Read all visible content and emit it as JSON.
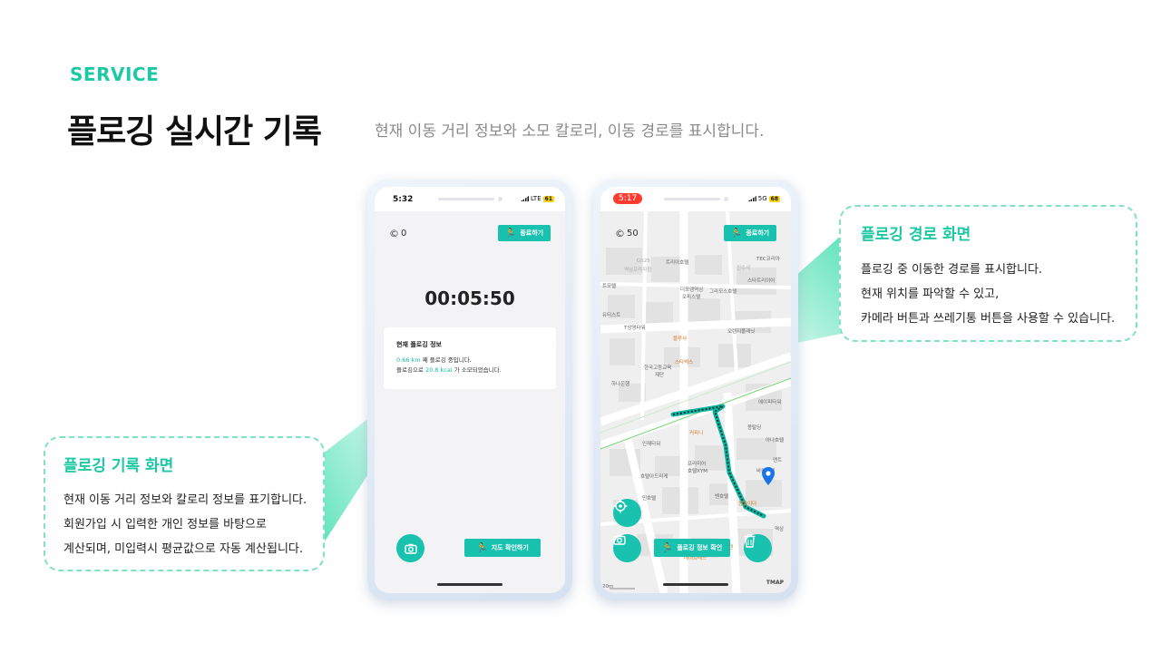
{
  "header": {
    "section_label": "SERVICE",
    "title": "플로깅 실시간 기록",
    "subtitle": "현재 이동 거리 정보와 소모 칼로리, 이동 경로를 표시합니다."
  },
  "phone_record": {
    "status_time": "5:32",
    "network": "LTE",
    "battery": "61",
    "coins": "0",
    "stop_button": "종료하기",
    "timer": "00:05:50",
    "info_title": "현재 플로깅 정보",
    "distance": "0.66 km",
    "distance_suffix": " 째 플로깅 중입니다.",
    "calorie_prefix": "플로깅으로 ",
    "calories": "20.8 kcal",
    "calorie_suffix": " 가 소모되었습니다.",
    "map_button": "지도 확인하기"
  },
  "phone_route": {
    "status_time": "5:17",
    "network": "5G",
    "battery": "68",
    "coins": "50",
    "stop_button": "종료하기",
    "info_button": "플로깅 정보 확인",
    "map_brand": "TMAP",
    "scale": "20m",
    "map_labels": [
      "GS25",
      "역삼프라자점",
      "트리아호텔",
      "진수사",
      "TEC코리아",
      "더포엠역삼",
      "오피스텔",
      "그라모스호텔",
      "스타트리이어",
      "트모텔",
      "유티스트",
      "T상영타워",
      "블루사",
      "오렌지플래닛",
      "스타벅스",
      "한국고등교육",
      "재단",
      "하나은행",
      "에이피타워",
      "몽탈딩",
      "커피니",
      "아나호텔",
      "인재타워",
      "프리미어",
      "호텔XYM",
      "호텔아드리게",
      "앤트",
      "바캉호텔",
      "민호텔",
      "벤호텔",
      "몽들이다",
      "마구로젠",
      "데이브레드",
      "역삼"
    ],
    "accent_route": "#0fb5a2"
  },
  "callout_record": {
    "title": "플로깅 기록 화면",
    "lines": [
      "현재 이동 거리 정보와 칼로리 정보를 표기합니다.",
      "회원가입 시 입력한 개인 정보를 바탕으로",
      "계산되며, 미입력시 평균값으로 자동 계산됩니다."
    ]
  },
  "callout_route": {
    "title": "플로깅 경로 화면",
    "lines": [
      "플로깅 중 이동한 경로를 표시합니다.",
      "현재 위치를 파악할 수 있고,",
      "카메라 버튼과 쓰레기통 버튼을 사용할 수 있습니다."
    ]
  },
  "colors": {
    "accent": "#1cc9a4",
    "button": "#18c2ae",
    "dashed_border": "#7ee2c4"
  }
}
